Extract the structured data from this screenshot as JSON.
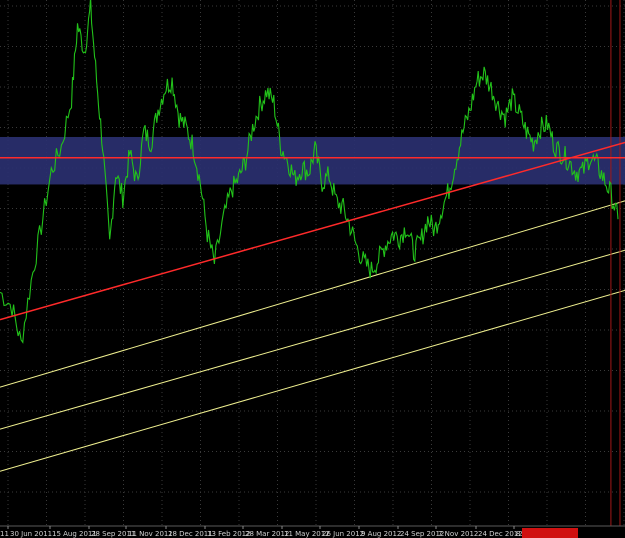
{
  "chart_data": {
    "type": "line",
    "title": "",
    "xlabel": "",
    "ylabel": "",
    "grid": true,
    "legend": "none",
    "colors": {
      "background": "#000000",
      "grid": "#3a3a3a",
      "price_line": "#22c21a",
      "zone_fill": "#2a3070",
      "horizontal_level": "#ff2a2a",
      "trendline": "#ff2a2a",
      "channel_lines": "#f0f090",
      "vertical_marker": "#a01818",
      "cursor_label_bg": "#d01010"
    },
    "x_tick_labels": [
      "11",
      "30 Jun 2011",
      "15 Aug 2011",
      "28 Sep 2011",
      "11 Nov 2011",
      "28 Dec 2011",
      "13 Feb 2012",
      "28 Mar 2012",
      "11 May 2012",
      "26 Jun 2012",
      "9 Aug 2012",
      "24 Sep 2012",
      "7 Nov 2012",
      "24 Dec 2012",
      "8"
    ],
    "cursor_label": "",
    "series": [
      {
        "x": [
          "2011-05-20",
          "2011-06-01",
          "2011-06-10",
          "2011-06-20",
          "2011-06-30",
          "2011-07-10",
          "2011-07-20",
          "2011-07-30",
          "2011-08-05",
          "2011-08-12",
          "2011-08-18",
          "2011-08-24",
          "2011-08-30",
          "2011-09-06",
          "2011-09-12",
          "2011-09-19",
          "2011-09-26",
          "2011-10-03",
          "2011-10-10",
          "2011-10-17",
          "2011-10-24",
          "2011-10-31",
          "2011-11-07",
          "2011-11-14",
          "2011-11-21",
          "2011-11-28",
          "2011-12-05",
          "2011-12-12",
          "2011-12-19",
          "2011-12-28",
          "2012-01-05",
          "2012-01-12",
          "2012-01-19",
          "2012-01-26",
          "2012-02-02",
          "2012-02-09",
          "2012-02-16",
          "2012-02-23",
          "2012-03-01",
          "2012-03-08",
          "2012-03-15",
          "2012-03-22",
          "2012-03-28",
          "2012-04-04",
          "2012-04-11",
          "2012-04-18",
          "2012-04-25",
          "2012-05-02",
          "2012-05-09",
          "2012-05-16",
          "2012-05-23",
          "2012-05-30",
          "2012-06-06",
          "2012-06-13",
          "2012-06-20",
          "2012-06-27",
          "2012-07-04",
          "2012-07-11",
          "2012-07-18",
          "2012-07-25",
          "2012-08-01",
          "2012-08-08",
          "2012-08-15",
          "2012-08-22",
          "2012-08-29",
          "2012-09-05",
          "2012-09-12",
          "2012-09-19",
          "2012-09-26",
          "2012-10-03",
          "2012-10-10",
          "2012-10-17",
          "2012-10-24",
          "2012-10-31",
          "2012-11-07",
          "2012-11-14",
          "2012-11-21",
          "2012-11-28",
          "2012-12-05",
          "2012-12-12",
          "2012-12-19",
          "2012-12-26",
          "2013-01-02",
          "2013-01-09",
          "2013-01-16",
          "2013-01-23"
        ],
        "y": [
          0.22,
          0.18,
          0.08,
          0.25,
          0.4,
          0.55,
          0.62,
          0.75,
          0.95,
          0.88,
          1.0,
          0.8,
          0.62,
          0.35,
          0.55,
          0.48,
          0.6,
          0.52,
          0.66,
          0.63,
          0.72,
          0.78,
          0.8,
          0.7,
          0.67,
          0.62,
          0.52,
          0.38,
          0.3,
          0.42,
          0.5,
          0.53,
          0.58,
          0.67,
          0.73,
          0.77,
          0.74,
          0.62,
          0.58,
          0.53,
          0.56,
          0.55,
          0.61,
          0.52,
          0.54,
          0.47,
          0.45,
          0.4,
          0.34,
          0.3,
          0.28,
          0.31,
          0.35,
          0.38,
          0.37,
          0.4,
          0.33,
          0.36,
          0.42,
          0.39,
          0.45,
          0.5,
          0.58,
          0.66,
          0.72,
          0.8,
          0.82,
          0.78,
          0.73,
          0.7,
          0.75,
          0.71,
          0.66,
          0.63,
          0.67,
          0.68,
          0.62,
          0.6,
          0.58,
          0.55,
          0.55,
          0.59,
          0.57,
          0.53,
          0.49,
          0.42
        ]
      }
    ],
    "overlays": {
      "support_zone": {
        "y_low": 0.515,
        "y_high": 0.645
      },
      "horizontal_level": {
        "y": 0.588
      },
      "trendline": {
        "from": [
          "2011-05-20",
          0.145
        ],
        "to": [
          "2013-01-30",
          0.63
        ]
      },
      "channel_lines": [
        {
          "from": [
            "2011-05-20",
            -0.04
          ],
          "to": [
            "2013-01-30",
            0.47
          ]
        },
        {
          "from": [
            "2011-05-20",
            -0.155
          ],
          "to": [
            "2013-01-30",
            0.335
          ]
        },
        {
          "from": [
            "2011-05-20",
            -0.27
          ],
          "to": [
            "2013-01-30",
            0.225
          ]
        }
      ],
      "vertical_markers": [
        "2013-01-16",
        "2013-01-25"
      ]
    },
    "ylim": [
      -0.42,
      1.02
    ]
  }
}
